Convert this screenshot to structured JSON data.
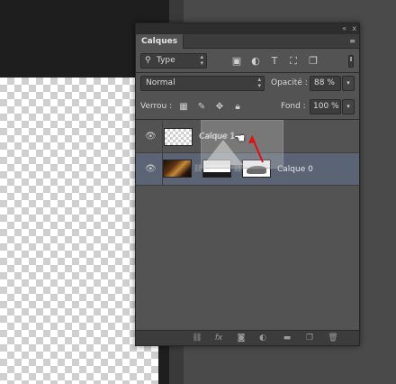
{
  "panel": {
    "tab_label": "Calques",
    "collapse_glyph": "«",
    "close_glyph": "x",
    "menu_glyph": "≡"
  },
  "filter": {
    "kind_value": "Type",
    "icons": [
      "image-filter-icon",
      "adjustment-filter-icon",
      "text-filter-icon",
      "shape-filter-icon",
      "smart-object-filter-icon"
    ]
  },
  "blend": {
    "mode_value": "Normal",
    "opacity_label": "Opacité :",
    "opacity_value": "88 %"
  },
  "lock": {
    "label": "Verrou :",
    "fill_label": "Fond :",
    "fill_value": "100 %"
  },
  "layers": [
    {
      "name": "Calque 1",
      "visible": true,
      "selected": false
    },
    {
      "name": "Calque 0",
      "visible": true,
      "selected": true
    }
  ],
  "drag_ghost": {
    "text": "Calque 1"
  },
  "footer_icons": [
    "link-layers-icon",
    "fx-icon",
    "add-mask-icon",
    "adjustment-layer-icon",
    "new-group-icon",
    "new-layer-icon",
    "delete-icon"
  ],
  "colors": {
    "selected_row": "#5a6474",
    "panel_bg": "#535353",
    "arrow": "#e01010"
  }
}
